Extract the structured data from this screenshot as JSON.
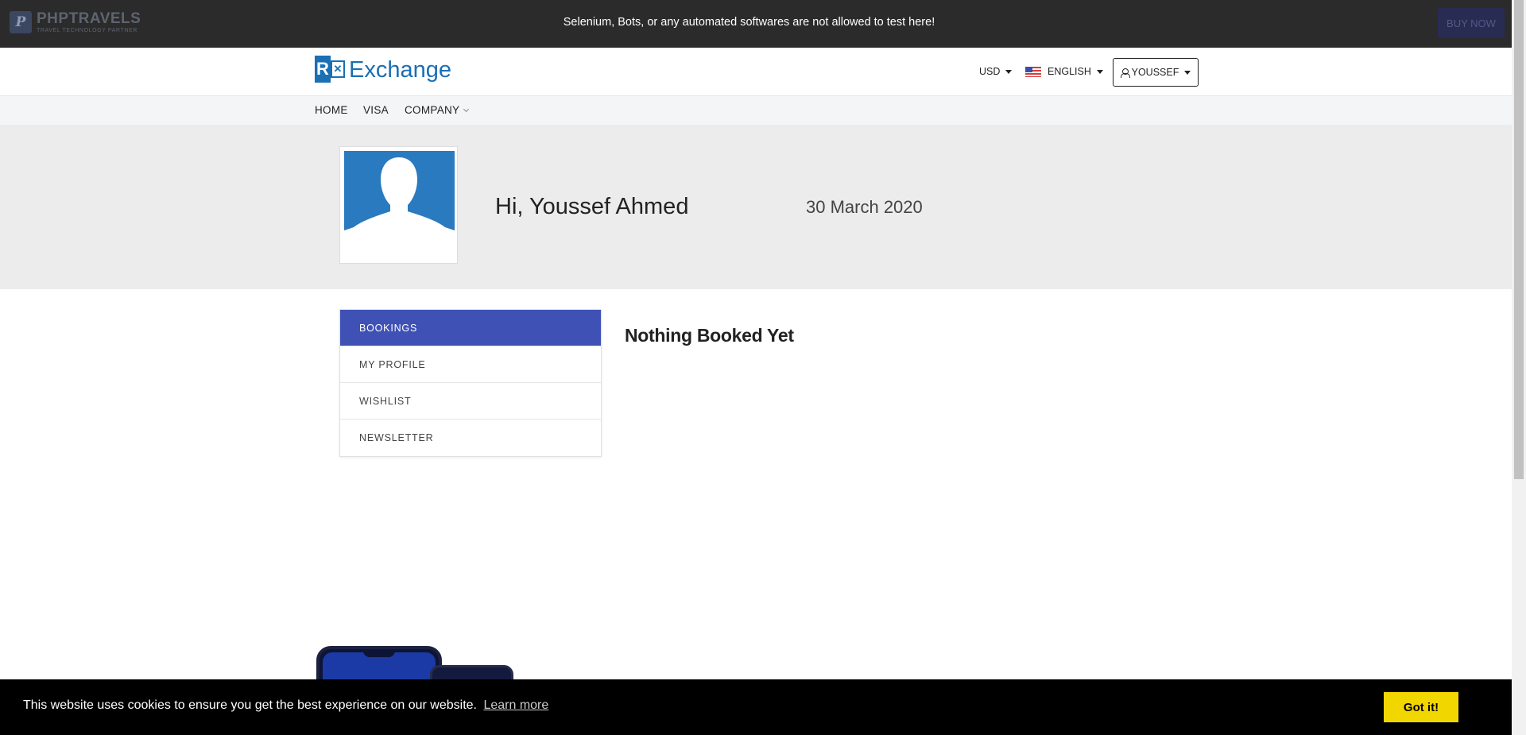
{
  "topbar": {
    "brand_name": "PHPTRAVELS",
    "brand_tagline": "TRAVEL TECHNOLOGY PARTNER",
    "notice": "Selenium, Bots, or any automated softwares are not allowed to test here!",
    "buy_now": "BUY NOW"
  },
  "header": {
    "logo_text": "Exchange",
    "logo_letter": "R",
    "currency": "USD",
    "language": "ENGLISH",
    "user": "YOUSSEF"
  },
  "nav": {
    "home": "HOME",
    "visa": "VISA",
    "company": "COMPANY"
  },
  "profile": {
    "greeting": "Hi, Youssef Ahmed",
    "date": "30 March 2020"
  },
  "side_menu": {
    "items": [
      {
        "label": "BOOKINGS",
        "active": true
      },
      {
        "label": "MY PROFILE",
        "active": false
      },
      {
        "label": "WISHLIST",
        "active": false
      },
      {
        "label": "NEWSLETTER",
        "active": false
      }
    ]
  },
  "content": {
    "empty_message": "Nothing Booked Yet"
  },
  "cookie": {
    "message": "This website uses cookies to ensure you get the best experience on our website.",
    "learn_more": "Learn more",
    "got_it": "Got it!"
  },
  "colors": {
    "accent": "#3f51b5",
    "logo_blue": "#1a6fb5",
    "cookie_button": "#f1d600"
  }
}
